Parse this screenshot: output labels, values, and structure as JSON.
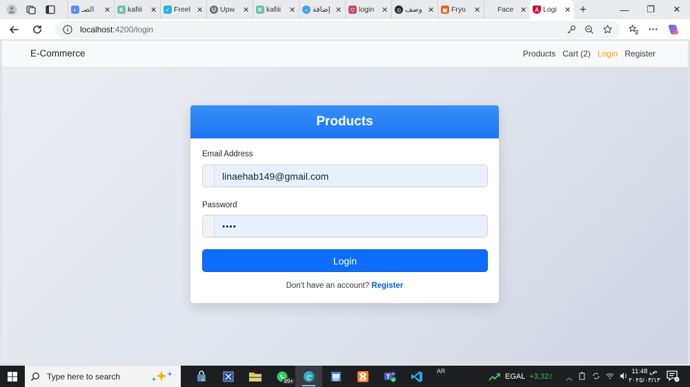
{
  "browser": {
    "tabs": [
      {
        "title": "الصـ",
        "color": "#5b8def",
        "glyph": "◐"
      },
      {
        "title": "kafiii",
        "color": "#6cc0a8",
        "glyph": "K"
      },
      {
        "title": "Freel",
        "color": "#29b2e0",
        "glyph": "✓"
      },
      {
        "title": "Upw",
        "color": "#707070",
        "glyph": "U"
      },
      {
        "title": "kafiii",
        "color": "#6cc0a8",
        "glyph": "K"
      },
      {
        "title": "إضافة",
        "color": "#3fa0e8",
        "glyph": "○"
      },
      {
        "title": "login",
        "color": "#c24b6b",
        "glyph": "▽"
      },
      {
        "title": "وصف",
        "color": "#222222",
        "glyph": "◎"
      },
      {
        "title": "Fryo",
        "color": "#e0632a",
        "glyph": "▣"
      },
      {
        "title": "Face",
        "color": "#ffffff",
        "glyph": ""
      }
    ],
    "active_tab": {
      "title": "Logi",
      "color": "#dd0031",
      "glyph": "A"
    },
    "new_tab_label": "+",
    "url_host": "localhost",
    "url_rest": ":4200/login",
    "window_controls": {
      "minimize": "—",
      "maximize": "❐",
      "close": "✕"
    }
  },
  "navbar": {
    "brand": "E-Commerce",
    "links": [
      {
        "label": "Products"
      },
      {
        "label": "Cart (2)"
      },
      {
        "label": "Login"
      },
      {
        "label": "Register"
      }
    ]
  },
  "login": {
    "header": "Products",
    "email_label": "Email Address",
    "email_value": "linaehab149@gmail.com",
    "password_label": "Password",
    "password_value": "••••",
    "submit_label": "Login",
    "register_prompt": "Don't have an account?",
    "register_link": "Register"
  },
  "taskbar": {
    "search_placeholder": "Type here to search",
    "whatsapp_badge": "99+",
    "lang": "AR",
    "stock_name": "EGAL",
    "stock_change": "+3,32٪",
    "time": "11:48 ص",
    "date": "٢٠٢٥/٠٣/١٣",
    "accent": "#0d6efd"
  }
}
